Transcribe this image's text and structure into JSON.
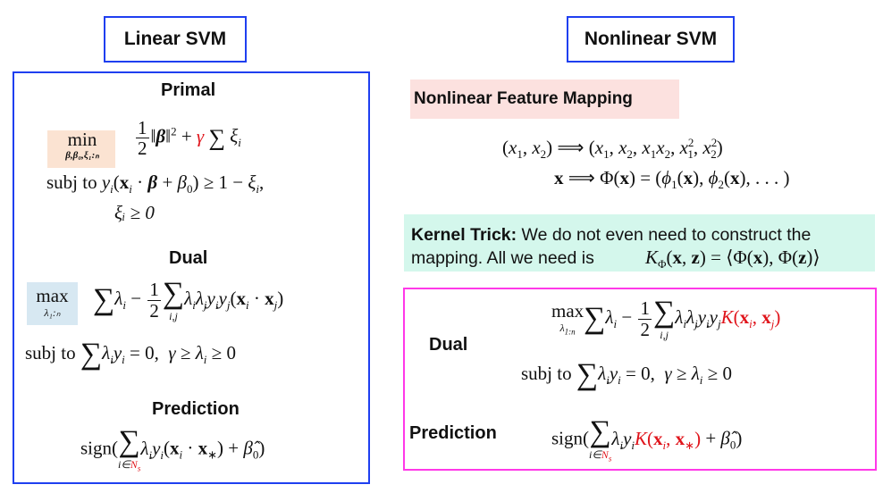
{
  "left": {
    "title": "Linear SVM",
    "primal": {
      "heading": "Primal",
      "min_label": "min",
      "min_subscript": "β,β₀,ξ₁:ₙ",
      "subj_to": "subj to",
      "constraint_nonneg": "ξᵢ ≥ 0"
    },
    "dual": {
      "heading": "Dual",
      "max_label": "max",
      "max_subscript": "λ₁:ₙ",
      "subj_to": "subj to"
    },
    "prediction": {
      "heading": "Prediction",
      "sign": "sign("
    }
  },
  "right": {
    "title": "Nonlinear SVM",
    "feature_mapping_label": "Nonlinear Feature Mapping",
    "kernel_trick_label": "Kernel Trick:",
    "kernel_trick_text1": " We do not even need to construct the",
    "kernel_trick_text2": "mapping. All we need is",
    "dual_label": "Dual",
    "prediction_label": "Prediction",
    "max_label": "max",
    "subj_to": "subj to",
    "sign": "sign("
  },
  "colors": {
    "blue_border": "#1f3ff0",
    "pink_border": "#ff39e8",
    "red_text": "#e0141b",
    "orange_highlight": "#fbe3d2",
    "blue_highlight": "#d7e8f2",
    "pink_highlight": "#fce1df",
    "teal_highlight": "#d4f7ec"
  }
}
